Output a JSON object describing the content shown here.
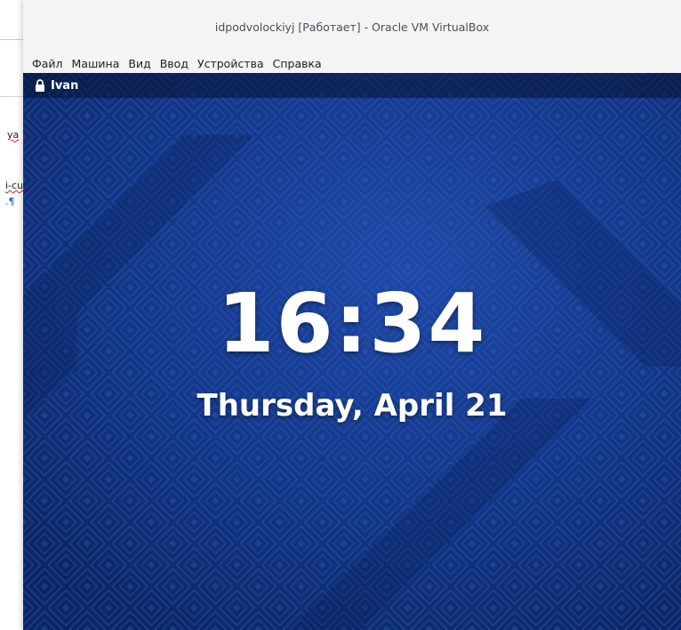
{
  "background_doc": {
    "fragments": [
      "ya",
      "i-cu",
      ".¶"
    ]
  },
  "window": {
    "title": "idpodvolockiyj [Работает] - Oracle VM VirtualBox"
  },
  "menu": {
    "items": [
      "Файл",
      "Машина",
      "Вид",
      "Ввод",
      "Устройства",
      "Справка"
    ]
  },
  "guest": {
    "topbar": {
      "lock_icon": "lock-icon",
      "user": "Ivan"
    },
    "lock_screen": {
      "time": "16:34",
      "date": "Thursday, April 21"
    }
  },
  "colors": {
    "screen_bg": "#143a8f",
    "pattern": "#2a5cc4",
    "topbar_bg": "#0a1430",
    "text": "#ffffff"
  }
}
